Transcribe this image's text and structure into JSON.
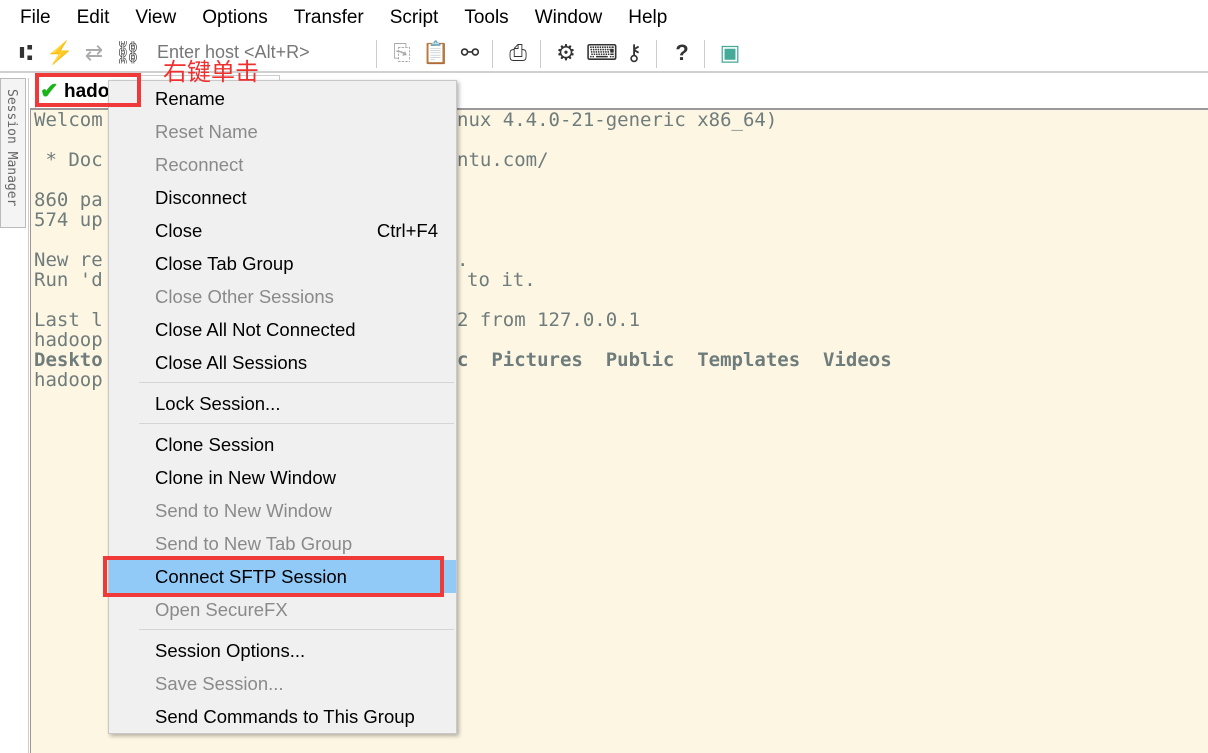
{
  "menubar": [
    "File",
    "Edit",
    "View",
    "Options",
    "Transfer",
    "Script",
    "Tools",
    "Window",
    "Help"
  ],
  "toolbar": {
    "host_placeholder": "Enter host <Alt+R>"
  },
  "annotation": "右键单击",
  "side_tab": "Session Manager",
  "tab": {
    "label": "hado",
    "status": "connected"
  },
  "terminal": {
    "left": [
      "Welcom",
      " * Doc",
      "860 pa",
      "574 up",
      "New re",
      "Run 'd",
      "Last l",
      "hadoop",
      "Deskto",
      "hadoop"
    ],
    "right": [
      "nux 4.4.0-21-generic x86_64)",
      "ntu.com/",
      ".",
      "to it.",
      "2 from 127.0.0.1",
      "c  Pictures  Public  Templates  Videos"
    ]
  },
  "context_menu": [
    {
      "label": "Rename",
      "enabled": true
    },
    {
      "label": "Reset Name",
      "enabled": false
    },
    {
      "label": "Reconnect",
      "enabled": false
    },
    {
      "label": "Disconnect",
      "enabled": true
    },
    {
      "label": "Close",
      "shortcut": "Ctrl+F4",
      "enabled": true
    },
    {
      "label": "Close Tab Group",
      "enabled": true
    },
    {
      "label": "Close Other Sessions",
      "enabled": false
    },
    {
      "label": "Close All Not Connected",
      "enabled": true
    },
    {
      "label": "Close All Sessions",
      "enabled": true
    },
    {
      "label": "Lock Session...",
      "enabled": true
    },
    {
      "label": "Clone Session",
      "enabled": true
    },
    {
      "label": "Clone in New Window",
      "enabled": true
    },
    {
      "label": "Send to New Window",
      "enabled": false
    },
    {
      "label": "Send to New Tab Group",
      "enabled": false
    },
    {
      "label": "Connect SFTP Session",
      "enabled": true,
      "highlighted": true
    },
    {
      "label": "Open SecureFX",
      "enabled": false
    },
    {
      "label": "Session Options...",
      "enabled": true
    },
    {
      "label": "Save Session...",
      "enabled": false
    },
    {
      "label": "Send Commands to This Group",
      "enabled": true
    }
  ],
  "colors": {
    "highlight": "#91c9f7",
    "annotation": "#f03a3a",
    "terminal_bg": "#fdf6e3"
  }
}
